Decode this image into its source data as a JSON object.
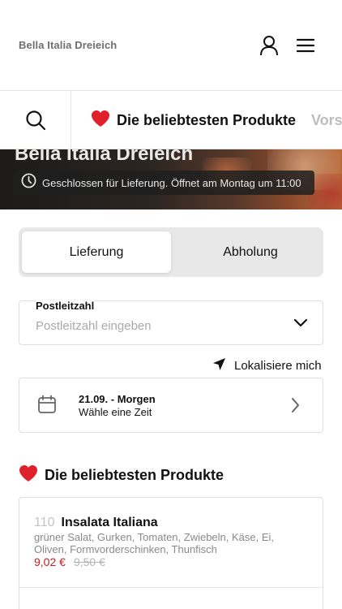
{
  "header": {
    "brand": "Bella Italia Dreieich",
    "user_icon": "user-icon",
    "menu_icon": "hamburger-menu-icon"
  },
  "categories": {
    "search_icon": "search-icon",
    "active": {
      "emoji": "❤️",
      "label": "Die beliebtesten Produkte"
    },
    "next": {
      "label": "Vors"
    }
  },
  "hero": {
    "title": "Bella Italia Dreieich",
    "status_icon": "clock-icon",
    "status": "Geschlossen für Lieferung. Öffnet am Montag um 11:00"
  },
  "order_mode": {
    "options": [
      "Lieferung",
      "Abholung"
    ],
    "selected": "Lieferung"
  },
  "zip": {
    "label": "Postleitzahl",
    "placeholder": "Postleitzahl eingeben",
    "value": ""
  },
  "locate": {
    "icon": "location-arrow-icon",
    "label": "Lokalisiere mich"
  },
  "delivery_time": {
    "icon": "calendar-icon",
    "date": "21.09. - Morgen",
    "subtitle": "Wähle eine Zeit"
  },
  "section": {
    "emoji": "❤️",
    "title": "Die beliebtesten Produkte"
  },
  "products": [
    {
      "number": "110",
      "name": "Insalata Italiana",
      "description": "grüner Salat, Gurken, Tomaten, Zwiebeln, Käse,  Ei, Oliven, Formvorderschinken, Thunfisch",
      "price": "9,02 €",
      "old_price": "9,50 €"
    }
  ],
  "colors": {
    "accent_red": "#c3201f",
    "muted_gray": "#8a8a8a",
    "border": "#dedede"
  }
}
